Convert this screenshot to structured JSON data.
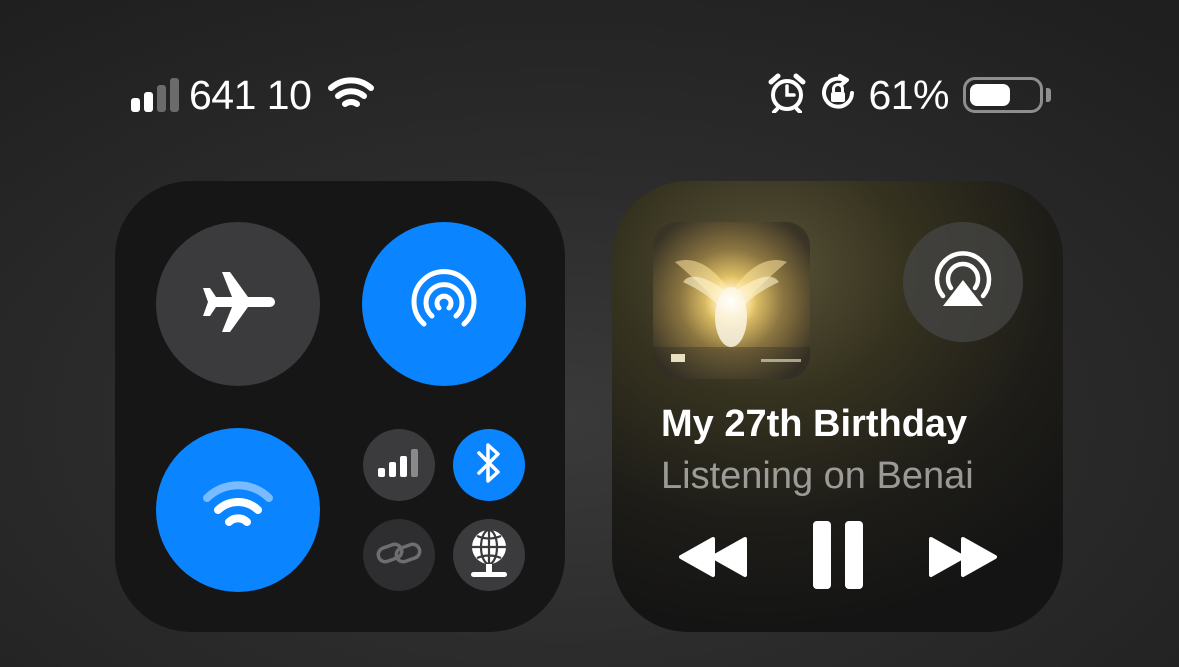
{
  "status_bar": {
    "carrier": "641 10",
    "battery_percent": "61%",
    "battery_level": 0.61,
    "signal_bars_active": 2,
    "signal_bars_total": 4,
    "icons": [
      "cellular-signal-icon",
      "wifi-icon",
      "alarm-icon",
      "rotation-lock-icon",
      "battery-icon"
    ]
  },
  "connectivity": {
    "airplane_mode": {
      "icon": "airplane-icon",
      "active": false
    },
    "airdrop": {
      "icon": "airdrop-icon",
      "active": true
    },
    "wifi": {
      "icon": "wifi-icon",
      "active": true
    },
    "cellular_data": {
      "icon": "cellular-bars-icon",
      "active": false
    },
    "bluetooth": {
      "icon": "bluetooth-icon",
      "active": true
    },
    "personal_hotspot": {
      "icon": "hotspot-link-icon",
      "active": false
    },
    "vpn": {
      "icon": "globe-network-icon",
      "active": false
    }
  },
  "now_playing": {
    "title": "My 27th Birthday",
    "subtitle": "Listening on Benai",
    "airplay_icon": "airplay-audio-icon",
    "controls": [
      "rewind-icon",
      "pause-icon",
      "fast-forward-icon"
    ]
  },
  "colors": {
    "accent_blue": "#0a84ff",
    "inactive_button": "#3b3b3d",
    "panel_bg": "#161616"
  }
}
